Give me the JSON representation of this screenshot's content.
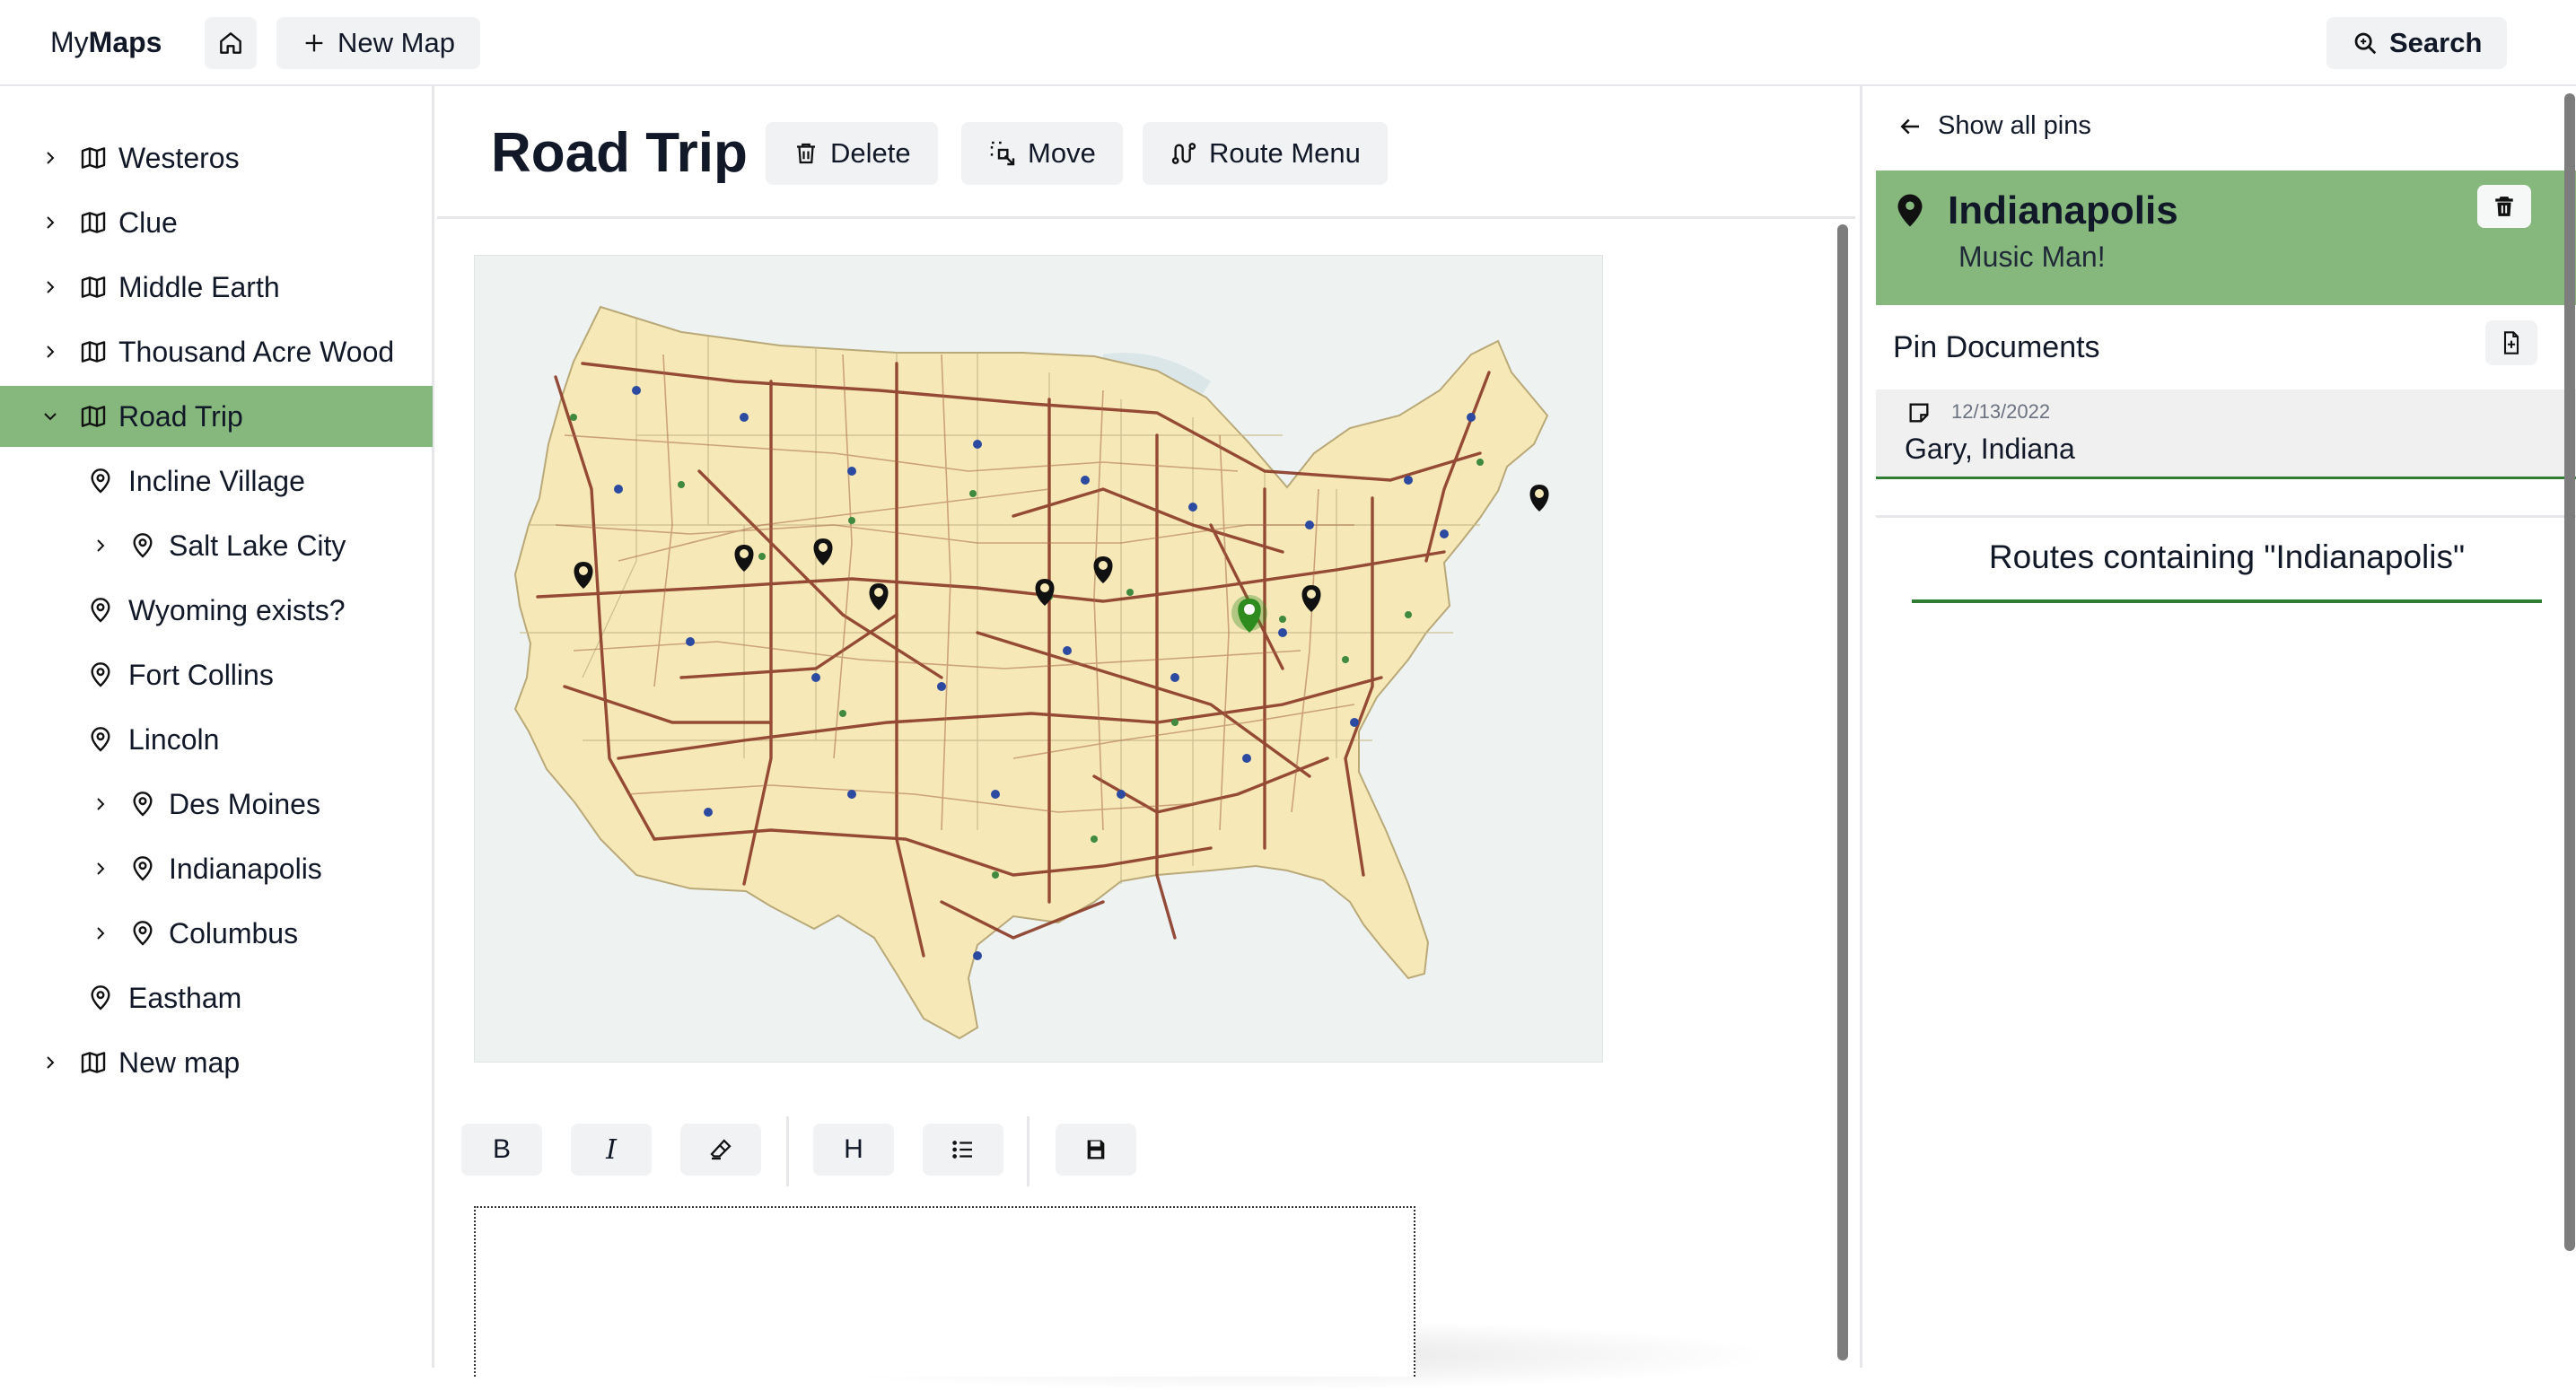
{
  "app": {
    "brand_prefix": "My",
    "brand_bold": "Maps"
  },
  "header": {
    "new_map_label": "New Map",
    "search_label": "Search"
  },
  "sidebar": {
    "items": [
      {
        "label": "Westeros",
        "type": "map",
        "expandable": true
      },
      {
        "label": "Clue",
        "type": "map",
        "expandable": true
      },
      {
        "label": "Middle Earth",
        "type": "map",
        "expandable": true
      },
      {
        "label": "Thousand Acre Wood",
        "type": "map",
        "expandable": true
      },
      {
        "label": "Road Trip",
        "type": "map",
        "expandable": true,
        "expanded": true,
        "selected": true
      },
      {
        "label": "Incline Village",
        "type": "pin"
      },
      {
        "label": "Salt Lake City",
        "type": "pin",
        "expandable": true
      },
      {
        "label": "Wyoming exists?",
        "type": "pin"
      },
      {
        "label": "Fort Collins",
        "type": "pin"
      },
      {
        "label": "Lincoln",
        "type": "pin"
      },
      {
        "label": "Des Moines",
        "type": "pin",
        "expandable": true
      },
      {
        "label": "Indianapolis",
        "type": "pin",
        "expandable": true
      },
      {
        "label": "Columbus",
        "type": "pin",
        "expandable": true
      },
      {
        "label": "Eastham",
        "type": "pin"
      },
      {
        "label": "New map",
        "type": "map",
        "expandable": true
      }
    ]
  },
  "main": {
    "title": "Road Trip",
    "actions": {
      "delete": "Delete",
      "move": "Move",
      "route_menu": "Route Menu"
    },
    "toolbar": {
      "bold": "B",
      "italic": "I",
      "heading": "H"
    },
    "colors": {
      "pin": "#111111",
      "active_pin": "#2e8b1e",
      "map_land": "#f7e9b8",
      "map_roads": "#8a3a26"
    }
  },
  "right_panel": {
    "back_label": "Show all pins",
    "pin": {
      "title": "Indianapolis",
      "subtitle": "Music Man!"
    },
    "documents_title": "Pin Documents",
    "documents": [
      {
        "date": "12/13/2022",
        "title": "Gary, Indiana"
      }
    ],
    "routes_title": "Routes containing \"Indianapolis\"",
    "accent": "#86b87d"
  }
}
